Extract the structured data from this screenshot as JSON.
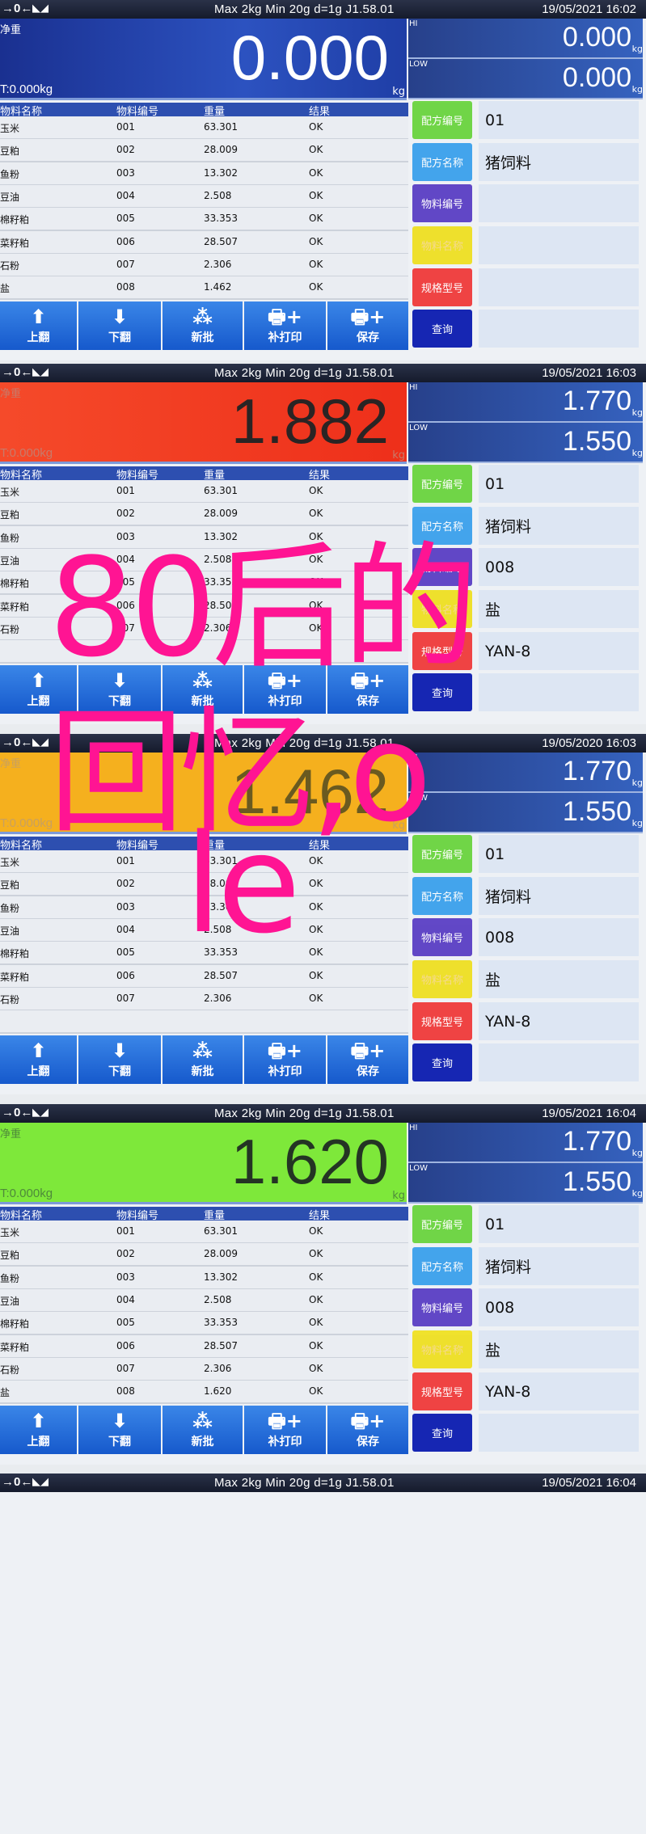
{
  "colors": {
    "header_bar": "#1b2235",
    "table_header": "#2d4fb0",
    "action_button": "#1e6ad8",
    "overlay_text": "#ff1493",
    "side_buttons": [
      "#6ad43e",
      "#3aa0ec",
      "#5a3ec4",
      "#efe022",
      "#f03a3a",
      "#0b1cb0"
    ]
  },
  "header": {
    "zero_icon": "→0←",
    "scale_icon": "scale-icon",
    "spec": "Max 2kg  Min 20g  d=1g    J1.58.01"
  },
  "labels": {
    "net_weight": "净重",
    "tare": "T:0.000kg",
    "unit": "kg",
    "hi": "HI",
    "low": "LOW"
  },
  "table_columns": [
    "物料名称",
    "物料编号",
    "重量",
    "结果"
  ],
  "action_buttons": [
    {
      "label": "上翻",
      "icon": "arrow-up-icon"
    },
    {
      "label": "下翻",
      "icon": "arrow-down-icon"
    },
    {
      "label": "新批",
      "icon": "batch-icon"
    },
    {
      "label": "补打印",
      "icon": "printer-plus-icon"
    },
    {
      "label": "保存",
      "icon": "printer-plus-icon"
    }
  ],
  "side_buttons": [
    "配方编号",
    "配方名称",
    "物料编号",
    "物料名称",
    "规格型号",
    "查询"
  ],
  "panels": [
    {
      "datetime": "19/05/2021  16:02",
      "weight": "0.000",
      "display_color": "blue",
      "hi": "0.000",
      "low": "0.000",
      "values": [
        "01",
        "猪饲料",
        "",
        "",
        ""
      ],
      "rows": [
        [
          "玉米",
          "001",
          "63.301",
          "OK"
        ],
        [
          "豆粕",
          "002",
          "28.009",
          "OK"
        ],
        [
          "鱼粉",
          "003",
          "13.302",
          "OK"
        ],
        [
          "豆油",
          "004",
          "2.508",
          "OK"
        ],
        [
          "棉籽粕",
          "005",
          "33.353",
          "OK"
        ],
        [
          "菜籽粕",
          "006",
          "28.507",
          "OK"
        ],
        [
          "石粉",
          "007",
          "2.306",
          "OK"
        ],
        [
          "盐",
          "008",
          "1.462",
          "OK"
        ]
      ]
    },
    {
      "datetime": "19/05/2021  16:03",
      "weight": "1.882",
      "display_color": "red",
      "hi": "1.770",
      "low": "1.550",
      "values": [
        "01",
        "猪饲料",
        "008",
        "盐",
        "YAN-8"
      ],
      "rows": [
        [
          "玉米",
          "001",
          "63.301",
          "OK"
        ],
        [
          "豆粕",
          "002",
          "28.009",
          "OK"
        ],
        [
          "鱼粉",
          "003",
          "13.302",
          "OK"
        ],
        [
          "豆油",
          "004",
          "2.508",
          "OK"
        ],
        [
          "棉籽粕",
          "005",
          "33.353",
          "OK"
        ],
        [
          "菜籽粕",
          "006",
          "28.507",
          "OK"
        ],
        [
          "石粉",
          "007",
          "2.306",
          "OK"
        ]
      ]
    },
    {
      "datetime": "19/05/2020  16:03",
      "weight": "1.462",
      "display_color": "orange",
      "hi": "1.770",
      "low": "1.550",
      "values": [
        "01",
        "猪饲料",
        "008",
        "盐",
        "YAN-8"
      ],
      "rows": [
        [
          "玉米",
          "001",
          "63.301",
          "OK"
        ],
        [
          "豆粕",
          "002",
          "28.009",
          "OK"
        ],
        [
          "鱼粉",
          "003",
          "13.302",
          "OK"
        ],
        [
          "豆油",
          "004",
          "2.508",
          "OK"
        ],
        [
          "棉籽粕",
          "005",
          "33.353",
          "OK"
        ],
        [
          "菜籽粕",
          "006",
          "28.507",
          "OK"
        ],
        [
          "石粉",
          "007",
          "2.306",
          "OK"
        ]
      ]
    },
    {
      "datetime": "19/05/2021  16:04",
      "weight": "1.620",
      "display_color": "green",
      "hi": "1.770",
      "low": "1.550",
      "values": [
        "01",
        "猪饲料",
        "008",
        "盐",
        "YAN-8"
      ],
      "rows": [
        [
          "玉米",
          "001",
          "63.301",
          "OK"
        ],
        [
          "豆粕",
          "002",
          "28.009",
          "OK"
        ],
        [
          "鱼粉",
          "003",
          "13.302",
          "OK"
        ],
        [
          "豆油",
          "004",
          "2.508",
          "OK"
        ],
        [
          "棉籽粕",
          "005",
          "33.353",
          "OK"
        ],
        [
          "菜籽粕",
          "006",
          "28.507",
          "OK"
        ],
        [
          "石粉",
          "007",
          "2.306",
          "OK"
        ],
        [
          "盐",
          "008",
          "1.620",
          "OK"
        ]
      ]
    },
    {
      "datetime": "19/05/2021  16:04"
    }
  ],
  "overlay": {
    "line1": "80后的",
    "line2": "回忆,o",
    "line3": "le"
  }
}
